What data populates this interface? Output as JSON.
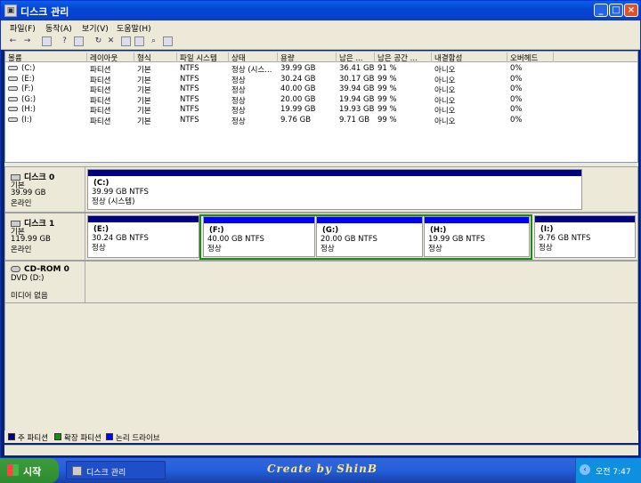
{
  "window": {
    "title": "디스크 관리",
    "minimize": "_",
    "maximize": "□",
    "close": "×"
  },
  "menu": [
    "파일(F)",
    "동작(A)",
    "보기(V)",
    "도움말(H)"
  ],
  "columns": [
    "볼륨",
    "레이아웃",
    "형식",
    "파일 시스템",
    "상태",
    "용량",
    "남은 ...",
    "남은 공간 ...",
    "내결함성",
    "오버헤드"
  ],
  "volumes": [
    [
      "(C:)",
      "파티션",
      "기본",
      "NTFS",
      "정상 (시스...",
      "39.99 GB",
      "36.41 GB",
      "91 %",
      "아니오",
      "0%"
    ],
    [
      "(E:)",
      "파티션",
      "기본",
      "NTFS",
      "정상",
      "30.24 GB",
      "30.17 GB",
      "99 %",
      "아니오",
      "0%"
    ],
    [
      "(F:)",
      "파티션",
      "기본",
      "NTFS",
      "정상",
      "40.00 GB",
      "39.94 GB",
      "99 %",
      "아니오",
      "0%"
    ],
    [
      "(G:)",
      "파티션",
      "기본",
      "NTFS",
      "정상",
      "20.00 GB",
      "19.94 GB",
      "99 %",
      "아니오",
      "0%"
    ],
    [
      "(H:)",
      "파티션",
      "기본",
      "NTFS",
      "정상",
      "19.99 GB",
      "19.93 GB",
      "99 %",
      "아니오",
      "0%"
    ],
    [
      "(I:)",
      "파티션",
      "기본",
      "NTFS",
      "정상",
      "9.76 GB",
      "9.71 GB",
      "99 %",
      "아니오",
      "0%"
    ]
  ],
  "disk0": {
    "name": "디스크 0",
    "type": "기본",
    "size": "39.99 GB",
    "status": "온라인",
    "partitions": [
      {
        "label": "(C:)",
        "size": "39.99 GB NTFS",
        "status": "정상 (시스템)"
      }
    ]
  },
  "disk1": {
    "name": "디스크 1",
    "type": "기본",
    "size": "119.99 GB",
    "status": "온라인",
    "partitions": [
      {
        "label": "(E:)",
        "size": "30.24 GB NTFS",
        "status": "정상"
      },
      {
        "label": "(F:)",
        "size": "40.00 GB NTFS",
        "status": "정상"
      },
      {
        "label": "(G:)",
        "size": "20.00 GB NTFS",
        "status": "정상"
      },
      {
        "label": "(H:)",
        "size": "19.99 GB NTFS",
        "status": "정상"
      },
      {
        "label": "(I:)",
        "size": "9.76 GB NTFS",
        "status": "정상"
      }
    ]
  },
  "cdrom": {
    "name": "CD-ROM 0",
    "drive": "DVD (D:)",
    "media": "미디어 없음"
  },
  "legend": [
    {
      "label": "주 파티션",
      "color": "#000080"
    },
    {
      "label": "확장 파티션",
      "color": "#1a8a1a"
    },
    {
      "label": "논리 드라이브",
      "color": "#0000ff"
    }
  ],
  "taskbar": {
    "start": "시작",
    "task": "디스크 관리",
    "brand": "Create by ShinB",
    "clock": "오전 7:47"
  }
}
